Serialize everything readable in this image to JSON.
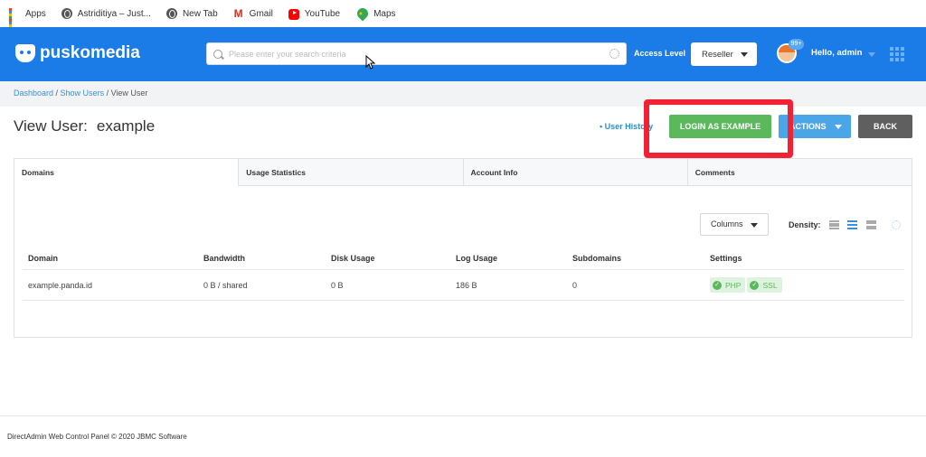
{
  "bookmarks": [
    {
      "label": "Apps",
      "icon": "apps-icon"
    },
    {
      "label": "Astriditiya – Just...",
      "icon": "globe-icon"
    },
    {
      "label": "New Tab",
      "icon": "globe-icon"
    },
    {
      "label": "Gmail",
      "icon": "gmail-icon"
    },
    {
      "label": "YouTube",
      "icon": "youtube-icon"
    },
    {
      "label": "Maps",
      "icon": "maps-icon"
    }
  ],
  "header": {
    "brand": "puskomedia",
    "search_placeholder": "Please enter your search criteria",
    "access_label": "Access Level",
    "access_value": "Reseller",
    "badge": "99+",
    "greeting": "Hello, admin"
  },
  "breadcrumb": {
    "home": "Dashboard",
    "parent": "Show Users",
    "current": "View User"
  },
  "page": {
    "title": "View User:",
    "username": "example",
    "user_history": "• User History",
    "login_button": "LOGIN AS EXAMPLE",
    "actions_button": "ACTIONS",
    "back_button": "BACK"
  },
  "tabs": [
    "Domains",
    "Usage Statistics",
    "Account Info",
    "Comments"
  ],
  "toolbar": {
    "columns_label": "Columns",
    "density_label": "Density:"
  },
  "table": {
    "headers": [
      "Domain",
      "Bandwidth",
      "Disk Usage",
      "Log Usage",
      "Subdomains",
      "Settings"
    ],
    "rows": [
      {
        "domain": "example.panda.id",
        "bandwidth": "0 B / shared",
        "disk": "0 B",
        "log": "186 B",
        "subdomains": "0",
        "settings": [
          "PHP",
          "SSL"
        ]
      }
    ]
  },
  "footer": "DirectAdmin Web Control Panel © 2020 JBMC Software",
  "colors": {
    "header": "#1b7ce8",
    "login": "#5cb85c",
    "actions": "#4aa6e6",
    "back": "#5f5f5f",
    "highlight": "#f22234"
  }
}
